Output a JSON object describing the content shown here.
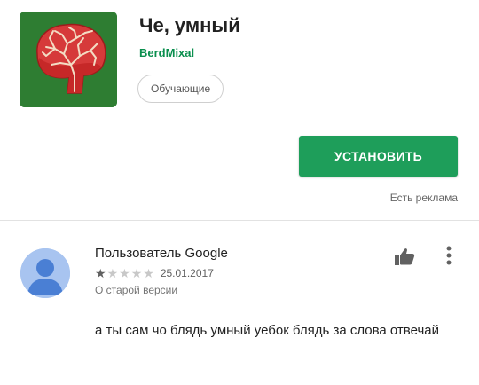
{
  "app": {
    "title": "Че, умный",
    "developer": "BerdMixal",
    "category": "Обучающие",
    "icon": "brain-icon"
  },
  "install": {
    "label": "УСТАНОВИТЬ",
    "ads_note": "Есть реклама"
  },
  "review": {
    "author": "Пользователь Google",
    "rating": 1,
    "max_rating": 5,
    "date": "25.01.2017",
    "version_note": "О старой версии",
    "text": "а ты сам чо блядь умный уебок блядь за слова отвечай",
    "avatar_icon": "user-avatar-icon",
    "helpful_icon": "thumbs-up-icon",
    "menu_icon": "more-vert-icon"
  },
  "colors": {
    "accent": "#1e9e5a",
    "developer": "#0a8f4e",
    "icon_background": "#2e7d32",
    "brain": "#d63a3a",
    "avatar": "#a8c4f0"
  }
}
